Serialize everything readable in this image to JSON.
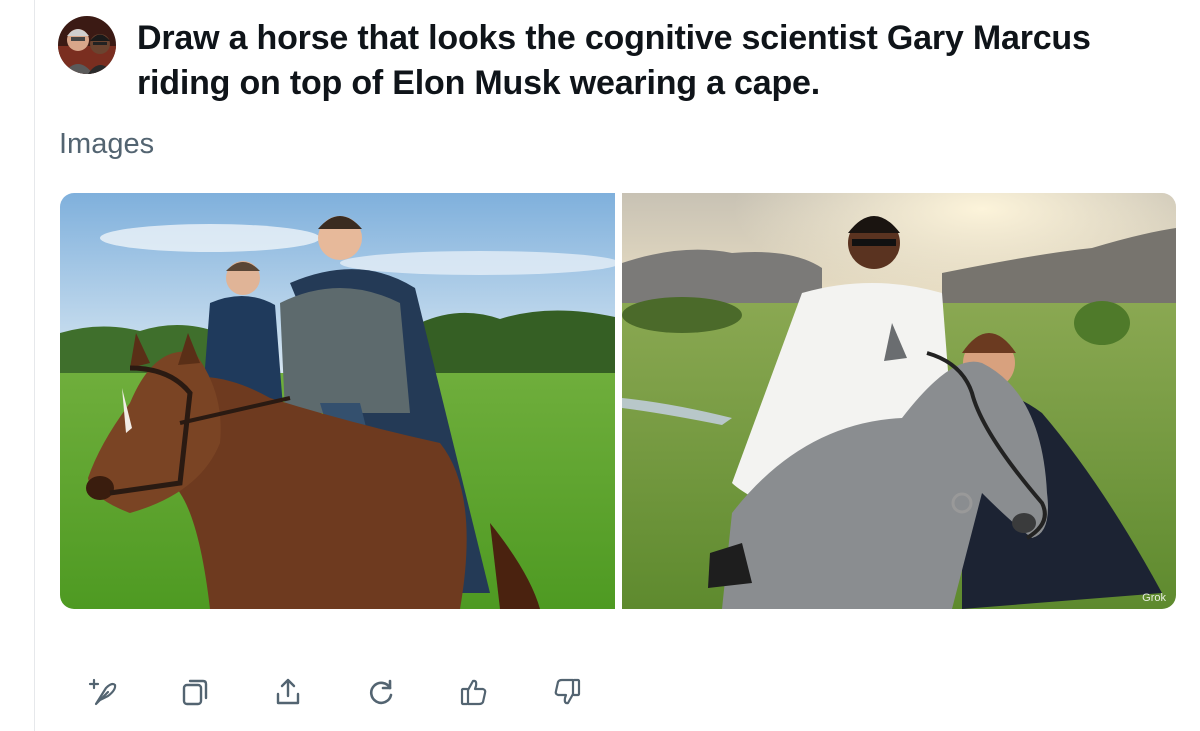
{
  "conversation": {
    "prompt": "Draw a horse that looks the cognitive scientist Gary Marcus riding on top of Elon Musk wearing a cape.",
    "section_label": "Images"
  },
  "images": [
    {
      "alt": "A brown horse carrying a caped rider in a green meadow",
      "watermark": ""
    },
    {
      "alt": "A man in a white coat riding a grey dappled horse at sunset",
      "watermark": "Grok"
    }
  ],
  "actions": [
    {
      "icon": "sparkle-feather-icon"
    },
    {
      "icon": "copy-icon"
    },
    {
      "icon": "share-icon"
    },
    {
      "icon": "regenerate-icon"
    },
    {
      "icon": "thumbs-up-icon"
    },
    {
      "icon": "thumbs-down-icon"
    }
  ],
  "colors": {
    "text_primary": "#0f1419",
    "text_secondary": "#536471",
    "divider": "#e6e8eb"
  }
}
